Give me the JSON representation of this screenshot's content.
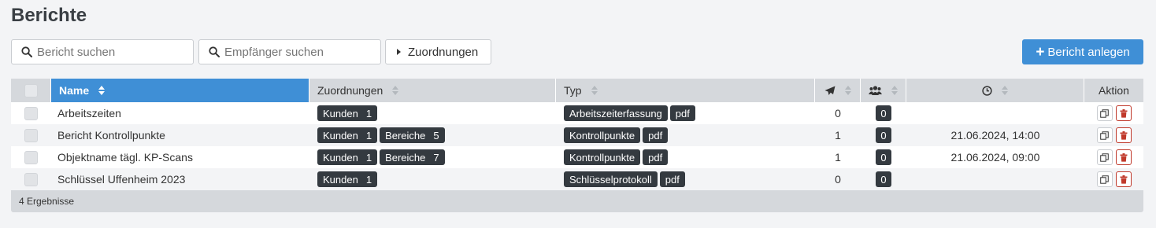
{
  "page": {
    "title": "Berichte"
  },
  "toolbar": {
    "report_search_placeholder": "Bericht suchen",
    "recipient_search_placeholder": "Empfänger suchen",
    "assignments_label": "Zuordnungen",
    "new_report_label": "Bericht anlegen"
  },
  "table": {
    "columns": {
      "name": "Name",
      "assignments": "Zuordnungen",
      "type": "Typ",
      "sent_icon": "paper-plane-icon",
      "recipients_icon": "users-icon",
      "time_icon": "clock-icon",
      "action": "Aktion"
    },
    "rows": [
      {
        "name": "Arbeitszeiten",
        "assignments": [
          {
            "label": "Kunden",
            "count": "1"
          }
        ],
        "types": [
          "Arbeitszeiterfassung",
          "pdf"
        ],
        "sent": "0",
        "recipients": "0",
        "timestamp": ""
      },
      {
        "name": "Bericht Kontrollpunkte",
        "assignments": [
          {
            "label": "Kunden",
            "count": "1"
          },
          {
            "label": "Bereiche",
            "count": "5"
          }
        ],
        "types": [
          "Kontrollpunkte",
          "pdf"
        ],
        "sent": "1",
        "recipients": "0",
        "timestamp": "21.06.2024, 14:00"
      },
      {
        "name": "Objektname tägl. KP-Scans",
        "assignments": [
          {
            "label": "Kunden",
            "count": "1"
          },
          {
            "label": "Bereiche",
            "count": "7"
          }
        ],
        "types": [
          "Kontrollpunkte",
          "pdf"
        ],
        "sent": "1",
        "recipients": "0",
        "timestamp": "21.06.2024, 09:00"
      },
      {
        "name": "Schlüssel Uffenheim 2023",
        "assignments": [
          {
            "label": "Kunden",
            "count": "1"
          }
        ],
        "types": [
          "Schlüsselprotokoll",
          "pdf"
        ],
        "sent": "0",
        "recipients": "0",
        "timestamp": ""
      }
    ],
    "footer": "4 Ergebnisse"
  },
  "colors": {
    "accent": "#3f8fd6",
    "header_bg": "#d5d8dc",
    "tag_bg": "#343a40",
    "danger": "#c0392b"
  }
}
